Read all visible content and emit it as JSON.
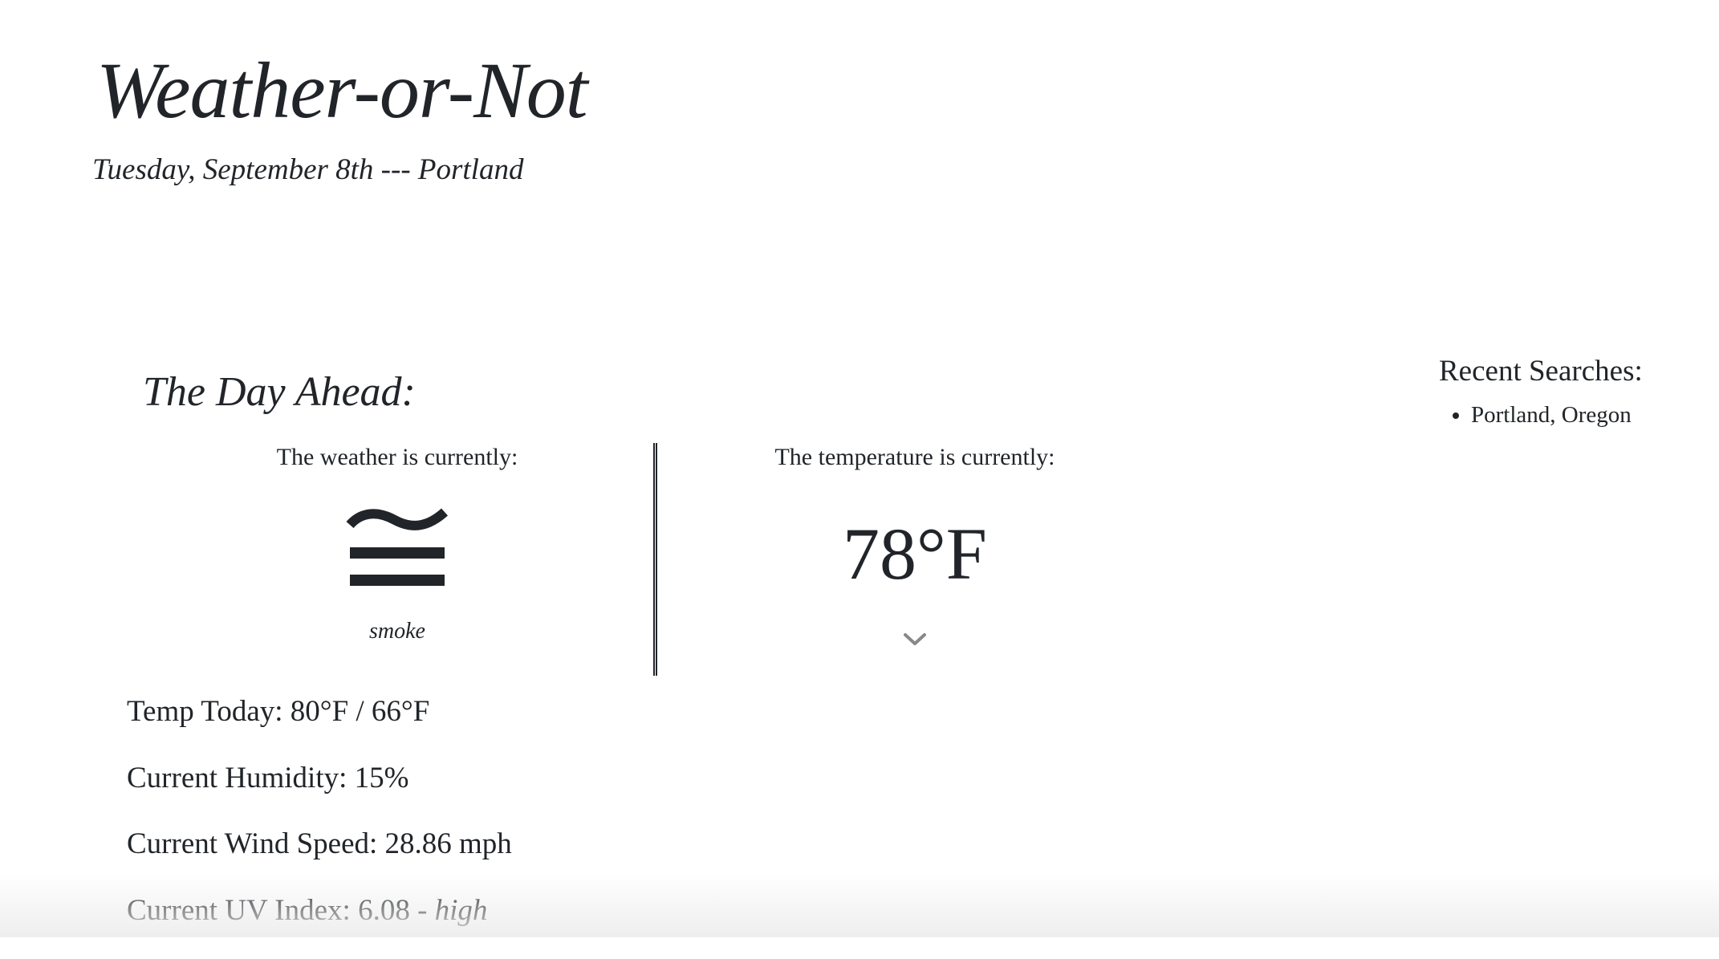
{
  "header": {
    "title": "Weather-or-Not",
    "subtitle": "Tuesday, September 8th --- Portland"
  },
  "today": {
    "heading": "The Day Ahead:",
    "weather_label": "The weather is currently:",
    "weather_icon": "smoke-icon",
    "weather_description": "smoke",
    "temperature_label": "The temperature is currently:",
    "temperature_value": "78°F",
    "expand_icon": "chevron-down-icon"
  },
  "stats": {
    "temp_today": "Temp Today: 80°F / 66°F",
    "humidity": "Current Humidity: 15%",
    "wind_speed": "Current Wind Speed: 28.86 mph",
    "uv_index_prefix": "Current UV Index: 6.08 - ",
    "uv_index_level": "high"
  },
  "recent_searches": {
    "title": "Recent Searches:",
    "items": [
      {
        "label": "Portland, Oregon"
      }
    ]
  },
  "colors": {
    "text": "#212529",
    "background": "#ffffff",
    "chevron": "#888888"
  }
}
